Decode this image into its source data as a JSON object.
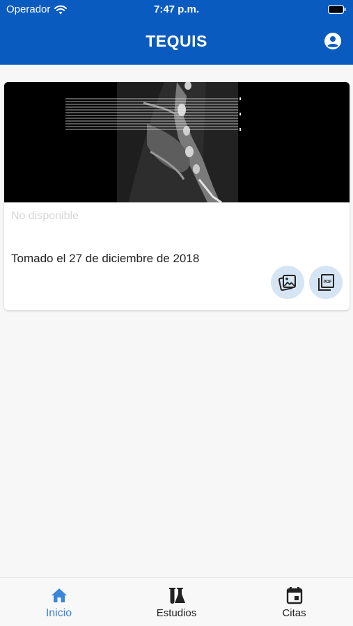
{
  "status_bar": {
    "carrier": "Operador",
    "time": "7:47 p.m."
  },
  "app_bar": {
    "title": "TEQUIS"
  },
  "card": {
    "availability_text": "No disponible",
    "taken_text": "Tomado el 27 de diciembre de 2018",
    "actions": {
      "image_icon": "image-gallery-icon",
      "pdf_icon": "pdf-icon"
    }
  },
  "tabs": [
    {
      "label": "Inicio",
      "icon": "home-icon",
      "active": true
    },
    {
      "label": "Estudios",
      "icon": "lab-flasks-icon",
      "active": false
    },
    {
      "label": "Citas",
      "icon": "calendar-icon",
      "active": false
    }
  ],
  "colors": {
    "primary": "#0a5bbf",
    "active_tab": "#3a86d8",
    "action_button_bg": "#d5e5f3",
    "background": "#f7f7f7"
  }
}
